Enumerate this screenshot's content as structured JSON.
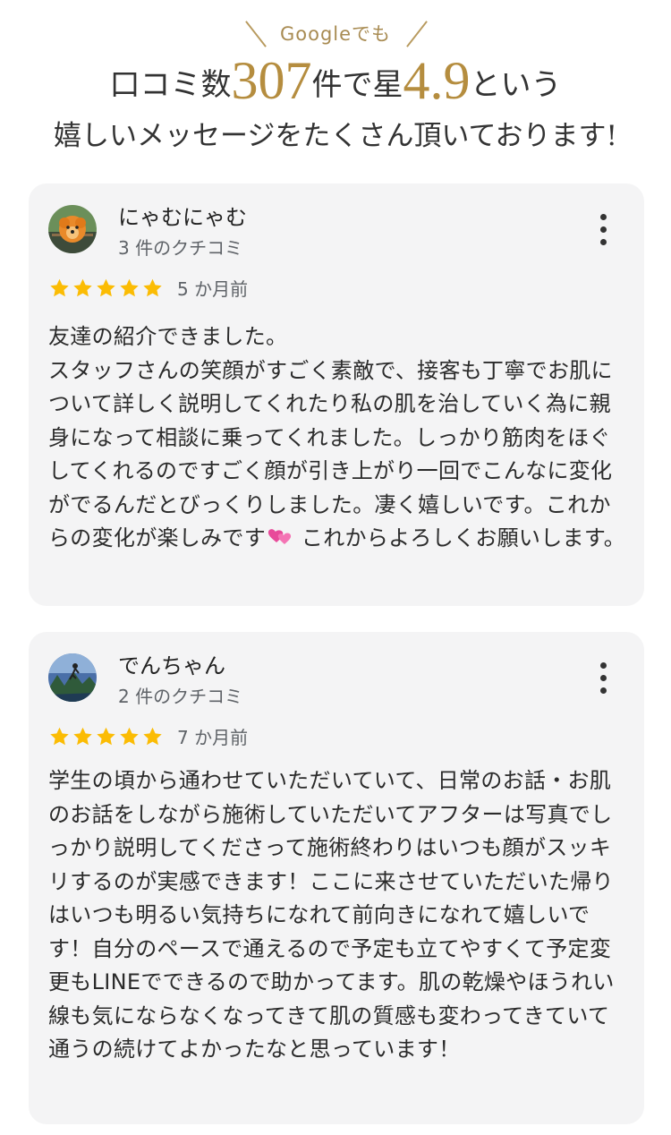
{
  "header": {
    "sub": "Googleでも",
    "headline_part1": "口コミ数",
    "review_count": "307",
    "headline_part2": "件で星",
    "rating": "4.9",
    "headline_part3": "という",
    "headline_line2": "嬉しいメッセージをたくさん頂いております!"
  },
  "colors": {
    "gold": "#b58d3f",
    "star": "#fbbc04",
    "card_bg": "#f4f4f5"
  },
  "reviews": [
    {
      "name": "にゃむにゃむ",
      "count": "3 件のクチコミ",
      "stars": 5,
      "date": "5 か月前",
      "text_before": "友達の紹介できました。\nスタッフさんの笑顔がすごく素敵で、接客も丁寧でお肌について詳しく説明してくれたり私の肌を治していく為に親身になって相談に乗ってくれました。しっかり筋肉をほぐしてくれるのですごく顔が引き上がり一回でこんなに変化がでるんだとびっくりしました。凄く嬉しいです。これからの変化が楽しみです",
      "emoji": "two-hearts-icon",
      "text_after": " これからよろしくお願いします。"
    },
    {
      "name": "でんちゃん",
      "count": "2 件のクチコミ",
      "stars": 5,
      "date": "7 か月前",
      "text": "学生の頃から通わせていただいていて、日常のお話・お肌のお話をしながら施術していただいてアフターは写真でしっかり説明してくださって施術終わりはいつも顔がスッキリするのが実感できます！ここに来させていただいた帰りはいつも明るい気持ちになれて前向きになれて嬉しいです！自分のペースで通えるので予定も立てやすくて予定変更もLINEでできるので助かってます。肌の乾燥やほうれい線も気にならなくなってきて肌の質感も変わってきていて通うの続けてよかったなと思っています！"
    }
  ]
}
